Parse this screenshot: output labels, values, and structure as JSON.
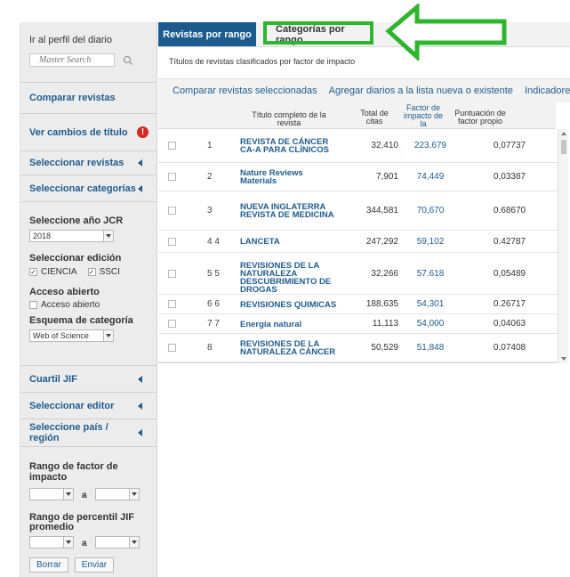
{
  "sidebar": {
    "profile_title": "Ir al perfil del diario",
    "search_placeholder": "Master Search",
    "compare_label": "Comparar revistas",
    "title_changes_label": "Ver cambios de título",
    "alert_glyph": "!",
    "select_journals_label": "Seleccionar revistas",
    "select_categories_label": "Seleccionar categorías",
    "jcr_year_label": "Seleccione año JCR",
    "jcr_year_value": "2018",
    "edition_label": "Seleccionar edición",
    "edition_sci_label": "CIENCIA",
    "edition_ssci_label": "SSCI",
    "open_access_title": "Acceso abierto",
    "open_access_option": "Acceso abierto",
    "category_schema_label": "Esquema de categoría",
    "category_schema_value": "Web of Science",
    "jif_quartile_label": "Cuartil JIF",
    "publisher_label": "Seleccionar editor",
    "country_label": "Seleccione país / región",
    "impact_range_label": "Rango de factor de impacto",
    "range_and": "a",
    "percentile_label": "Rango de percentil JIF promedio",
    "clear_button": "Borrar",
    "submit_button": "Enviar"
  },
  "tabs": {
    "active": "Revistas por rango",
    "inactive": "Categorías por rango"
  },
  "subtitle": "Títulos de revistas clasificados por factor de impacto",
  "actions": {
    "compare": "Comparar revistas seleccionadas",
    "add": "Agregar diarios a la lista nueva o existente",
    "indicators": "Indicadores personaliz"
  },
  "table": {
    "headers": {
      "title": "Título completo de la revista",
      "citations": "Total de citas",
      "jif": "Factor de impacto de la",
      "eigen": "Puntuación de factor propio"
    },
    "rows": [
      {
        "rank": "1",
        "title": "REVISTA DE CÁNCER CA-A PARA CLÍNICOS",
        "citations": "32,410",
        "jif": "223,679",
        "eigen": "0,07737"
      },
      {
        "rank": "2",
        "title": "Nature Reviews Materials",
        "citations": "7,901",
        "jif": "74,449",
        "eigen": "0,03387"
      },
      {
        "rank": "3",
        "title": "NUEVA INGLATERRA REVISTA DE MEDICINA",
        "citations": "344,581",
        "jif": "70,670",
        "eigen": "0.68670"
      },
      {
        "rank": "4 4",
        "title": "LANCETA",
        "citations": "247,292",
        "jif": "59,102",
        "eigen": "0.42787"
      },
      {
        "rank": "5 5",
        "title": "REVISIONES DE LA NATURALEZA DESCUBRIMIENTO DE DROGAS",
        "citations": "32,266",
        "jif": "57.618",
        "eigen": "0,05489"
      },
      {
        "rank": "6 6",
        "title": "REVISIONES QUIMICAS",
        "citations": "188,635",
        "jif": "54,301",
        "eigen": "0.26717"
      },
      {
        "rank": "7 7",
        "title": "Energía natural",
        "citations": "11,113",
        "jif": "54,000",
        "eigen": "0,04063"
      },
      {
        "rank": "8",
        "title": "REVISIONES DE LA NATURALEZA CÁNCER",
        "citations": "50,529",
        "jif": "51,848",
        "eigen": "0,07408"
      }
    ]
  },
  "colors": {
    "brand_blue": "#1d5a8e",
    "link_blue": "#1f5c8f",
    "highlight_green": "#2db52d",
    "alert_red": "#d4271d"
  }
}
